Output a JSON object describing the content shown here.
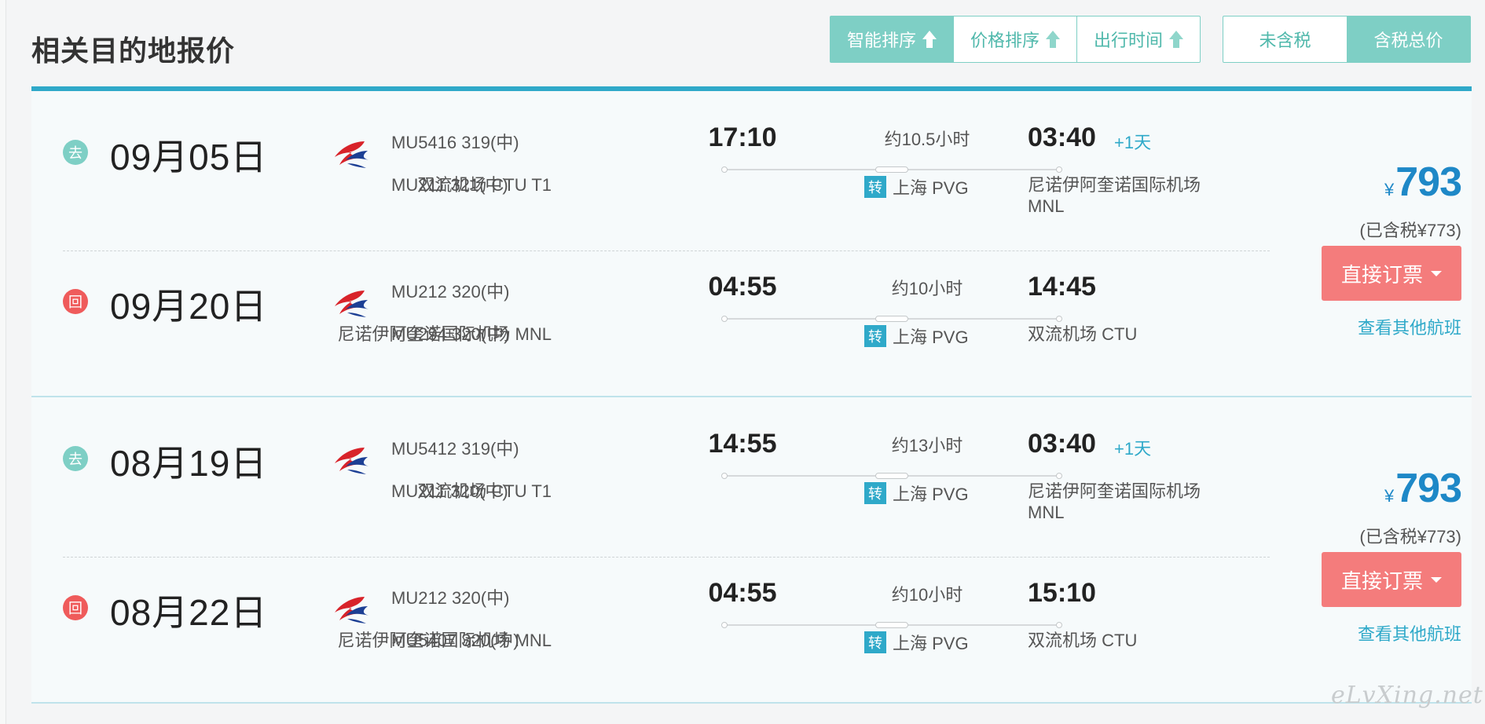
{
  "header": {
    "title": "相关目的地报价"
  },
  "sort": {
    "buttons": [
      {
        "label": "智能排序"
      },
      {
        "label": "价格排序"
      },
      {
        "label": "出行时间"
      }
    ],
    "tax": [
      {
        "label": "未含税"
      },
      {
        "label": "含税总价"
      }
    ]
  },
  "colors": {
    "accent": "#2fa9c9",
    "sort": "#7ecfc5",
    "book": "#f47c7c",
    "price": "#1e88c7",
    "return_badge": "#ef5b5b"
  },
  "results": [
    {
      "outbound": {
        "dir": "去",
        "date": "09月05日",
        "flight1": "MU5416 319(中)",
        "flight2": "MU211 321(中)",
        "dep_time": "17:10",
        "dep_airport": "双流机场 CTU T1",
        "duration": "约10.5小时",
        "transfer_label": "转",
        "transfer": "上海 PVG",
        "arr_time": "03:40",
        "plus_day": "+1天",
        "arr_airport": "尼诺伊阿奎诺国际机场 MNL"
      },
      "return": {
        "dir": "回",
        "date": "09月20日",
        "flight1": "MU212 320(中)",
        "flight2": "MU294 320(中)",
        "dep_time": "04:55",
        "dep_airport": "尼诺伊阿奎诺国际机场 MNL",
        "duration": "约10小时",
        "transfer_label": "转",
        "transfer": "上海 PVG",
        "arr_time": "14:45",
        "plus_day": "",
        "arr_airport": "双流机场 CTU"
      },
      "price": {
        "currency": "¥",
        "amount": "793",
        "tax_note": "(已含税¥773)",
        "book": "直接订票",
        "other": "查看其他航班"
      }
    },
    {
      "outbound": {
        "dir": "去",
        "date": "08月19日",
        "flight1": "MU5412 319(中)",
        "flight2": "MU211 320(中)",
        "dep_time": "14:55",
        "dep_airport": "双流机场 CTU T1",
        "duration": "约13小时",
        "transfer_label": "转",
        "transfer": "上海 PVG",
        "arr_time": "03:40",
        "plus_day": "+1天",
        "arr_airport": "尼诺伊阿奎诺国际机场 MNL"
      },
      "return": {
        "dir": "回",
        "date": "08月22日",
        "flight1": "MU212 320(中)",
        "flight2": "MU5407 320(中)",
        "dep_time": "04:55",
        "dep_airport": "尼诺伊阿奎诺国际机场 MNL",
        "duration": "约10小时",
        "transfer_label": "转",
        "transfer": "上海 PVG",
        "arr_time": "15:10",
        "plus_day": "",
        "arr_airport": "双流机场 CTU"
      },
      "price": {
        "currency": "¥",
        "amount": "793",
        "tax_note": "(已含税¥773)",
        "book": "直接订票",
        "other": "查看其他航班"
      }
    }
  ],
  "watermark": "eLvXing.net"
}
